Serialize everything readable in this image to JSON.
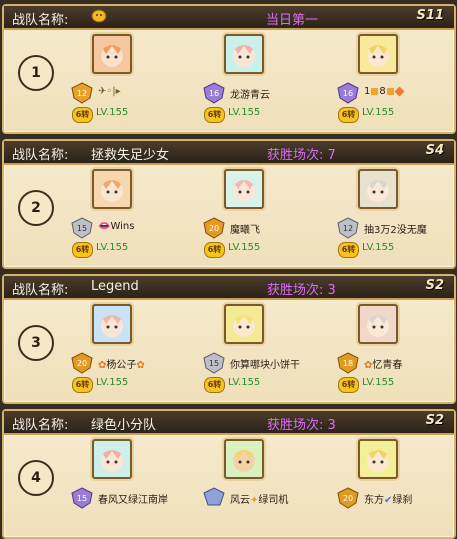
{
  "header_label": "战队名称:",
  "teams": [
    {
      "rank": "1",
      "name": "",
      "result": "当日第一",
      "season": "S11",
      "members": [
        {
          "name": "",
          "badge": "12",
          "badge_color": "#e8a326",
          "avatar_bg": "#f7c7a0",
          "hair": "#ee9b5e",
          "level": "LV.155",
          "upgrade": "6转"
        },
        {
          "name": "龙游青云",
          "badge": "16",
          "badge_color": "#9a7bd8",
          "avatar_bg": "#c9f1ea",
          "hair": "#f0b0a8",
          "level": "LV.155",
          "upgrade": "6转"
        },
        {
          "name": "1",
          "badge": "16",
          "badge_color": "#9a7bd8",
          "avatar_bg": "#f8ea9b",
          "hair": "#f4d35c",
          "level": "LV.155",
          "upgrade": "6转"
        }
      ]
    },
    {
      "rank": "2",
      "name": "拯救失足少女",
      "result": "获胜场次: 7",
      "season": "S4",
      "members": [
        {
          "name": "Wins",
          "badge": "15",
          "badge_color": "#bfbfc8",
          "avatar_bg": "#f8d7b0",
          "hair": "#f2a868",
          "level": "LV.155",
          "upgrade": "6转"
        },
        {
          "name": "魔曦飞",
          "badge": "20",
          "badge_color": "#e39a1f",
          "avatar_bg": "#d8f4ea",
          "hair": "#f0b8b0",
          "level": "LV.155",
          "upgrade": "6转"
        },
        {
          "name": "抽3万2没无魔",
          "badge": "12",
          "badge_color": "#bfbfc8",
          "avatar_bg": "#e9e1d0",
          "hair": "#d9d6cf",
          "level": "LV.155",
          "upgrade": "6转"
        }
      ]
    },
    {
      "rank": "3",
      "name": "Legend",
      "result": "获胜场次: 3",
      "season": "S2",
      "members": [
        {
          "name": "杨公子",
          "badge": "20",
          "badge_color": "#e39a1f",
          "avatar_bg": "#c9e3f4",
          "hair": "#f0b7a9",
          "level": "LV.155",
          "upgrade": "6转"
        },
        {
          "name": "你算哪块小饼干",
          "badge": "15",
          "badge_color": "#bfbfc8",
          "avatar_bg": "#f3ea95",
          "hair": "#f4e07a",
          "level": "LV.155",
          "upgrade": "6转"
        },
        {
          "name": "忆青春",
          "badge": "18",
          "badge_color": "#e39a1f",
          "avatar_bg": "#f1d7c9",
          "hair": "#d9d6cf",
          "level": "LV.155",
          "upgrade": "6转"
        }
      ]
    },
    {
      "rank": "4",
      "name": "绿色小分队",
      "result": "获胜场次: 3",
      "season": "S2",
      "members": [
        {
          "name": "春风又绿江南岸",
          "badge": "15",
          "badge_color": "#9a7bd8",
          "avatar_bg": "#ccefe9",
          "hair": "#f1b0a0",
          "level": "",
          "upgrade": ""
        },
        {
          "name": "风云",
          "badge": "",
          "badge_color": "#8ea2d8",
          "avatar_bg": "#d9f1bf",
          "hair": "#f5d07a",
          "level": "",
          "upgrade": ""
        },
        {
          "name": "东方",
          "badge": "20",
          "badge_color": "#e39a1f",
          "avatar_bg": "#f3ef98",
          "hair": "#f4d35c",
          "level": "",
          "upgrade": ""
        }
      ]
    }
  ],
  "extras": {
    "t1_name_icon": "smiley-icon",
    "t1_m1_extra": "symbol-decoration-icon",
    "t1_m3_extra": "8",
    "t2_m1_icon": "lips-icon",
    "t3_m1_icon": "flower-icon",
    "t3_m3_icon": "flower-icon",
    "t4_m2_suffix": "绿司机",
    "t4_m2_icon": "sparkle-icon",
    "t4_m3_suffix": "绿刹",
    "t4_m3_icon": "check-icon"
  }
}
